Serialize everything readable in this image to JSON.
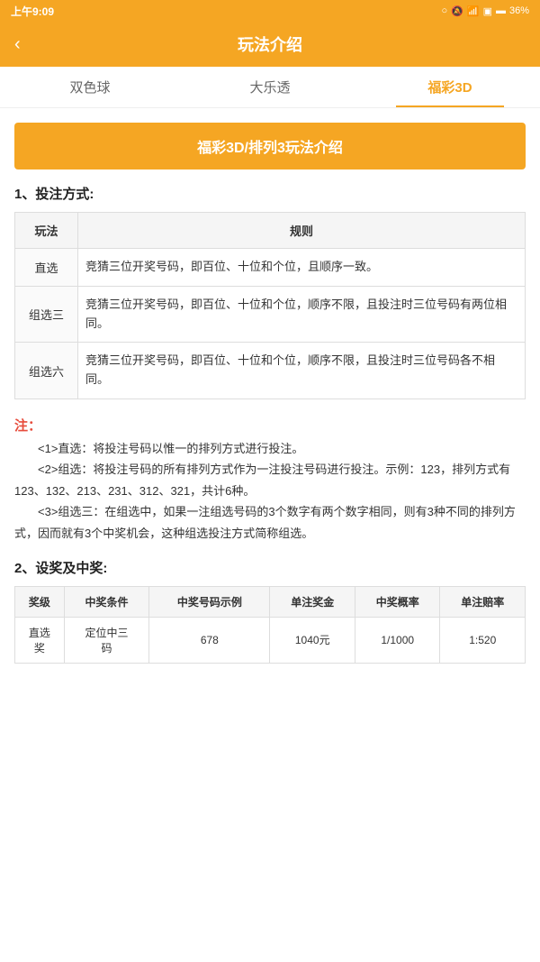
{
  "statusBar": {
    "time": "上午9:09",
    "battery": "36%"
  },
  "header": {
    "back": "‹",
    "title": "玩法介绍"
  },
  "tabs": [
    {
      "id": "tab1",
      "label": "双色球",
      "active": false
    },
    {
      "id": "tab2",
      "label": "大乐透",
      "active": false
    },
    {
      "id": "tab3",
      "label": "福彩3D",
      "active": true
    }
  ],
  "banner": {
    "text": "福彩3D/排列3玩法介绍"
  },
  "section1": {
    "title": "1、投注方式:",
    "tableHeaders": [
      "玩法",
      "规则"
    ],
    "rows": [
      {
        "name": "直选",
        "rule": "竞猜三位开奖号码，即百位、十位和个位，且顺序一致。"
      },
      {
        "name": "组选三",
        "rule": "竞猜三位开奖号码，即百位、十位和个位，顺序不限，且投注时三位号码有两位相同。"
      },
      {
        "name": "组选六",
        "rule": "竞猜三位开奖号码，即百位、十位和个位，顺序不限，且投注时三位号码各不相同。"
      }
    ]
  },
  "notes": {
    "label": "注：",
    "items": [
      "<1>直选：将投注号码以惟一的排列方式进行投注。",
      "<2>组选：将投注号码的所有排列方式作为一注投注号码进行投注。示例：123，排列方式有123、132、213、231、312、321，共计6种。",
      "<3>组选三：在组选中，如果一注组选号码的3个数字有两个数字相同，则有3种不同的排列方式，因而就有3个中奖机会，这种组选投注方式简称组选。"
    ]
  },
  "section2": {
    "title": "2、设奖及中奖:",
    "tableHeaders": [
      "奖级",
      "中奖条件",
      "中奖号码示例",
      "单注奖金",
      "中奖概率",
      "单注赔率"
    ],
    "rows": [
      {
        "level": "直选奖",
        "condition": "定位中三码",
        "example": "678",
        "prize": "1040元",
        "probability": "1/1000",
        "ratio": "1:520"
      }
    ]
  }
}
